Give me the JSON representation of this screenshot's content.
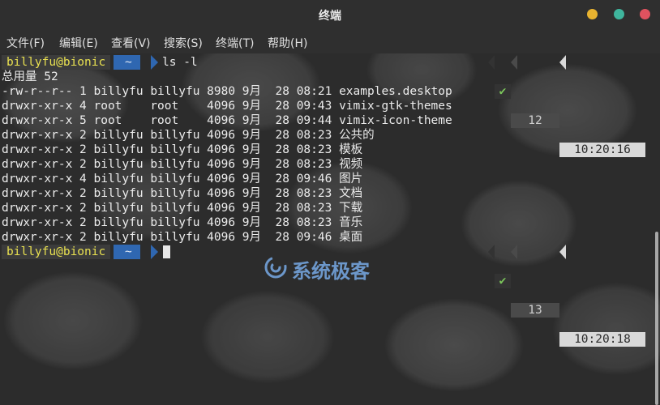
{
  "window": {
    "title": "终端",
    "buttons": [
      {
        "name": "minimize",
        "color": "#e8b330"
      },
      {
        "name": "maximize",
        "color": "#3fb59d"
      },
      {
        "name": "close",
        "color": "#e0525f"
      }
    ]
  },
  "menu": [
    "文件(F)",
    "编辑(E)",
    "查看(V)",
    "搜索(S)",
    "终端(T)",
    "帮助(H)"
  ],
  "prompt1": {
    "user": "billyfu@bionic",
    "dir": "~",
    "command": "ls -l",
    "status_icon": "checkmark-icon",
    "history_num": "12",
    "time": "10:20:16"
  },
  "total_line": "总用量 52",
  "listing": [
    "-rw-r--r-- 1 billyfu billyfu 8980 9月  28 08:21 examples.desktop",
    "drwxr-xr-x 4 root    root    4096 9月  28 09:43 vimix-gtk-themes",
    "drwxr-xr-x 5 root    root    4096 9月  28 09:44 vimix-icon-theme",
    "drwxr-xr-x 2 billyfu billyfu 4096 9月  28 08:23 公共的",
    "drwxr-xr-x 2 billyfu billyfu 4096 9月  28 08:23 模板",
    "drwxr-xr-x 2 billyfu billyfu 4096 9月  28 08:23 视频",
    "drwxr-xr-x 4 billyfu billyfu 4096 9月  28 09:46 图片",
    "drwxr-xr-x 2 billyfu billyfu 4096 9月  28 08:23 文档",
    "drwxr-xr-x 2 billyfu billyfu 4096 9月  28 08:23 下载",
    "drwxr-xr-x 2 billyfu billyfu 4096 9月  28 08:23 音乐",
    "drwxr-xr-x 2 billyfu billyfu 4096 9月  28 09:46 桌面"
  ],
  "prompt2": {
    "user": "billyfu@bionic",
    "dir": "~",
    "status_icon": "checkmark-icon",
    "history_num": "13",
    "time": "10:20:18"
  },
  "watermark": {
    "logo": "swirl-logo-icon",
    "text": "系统极客"
  }
}
